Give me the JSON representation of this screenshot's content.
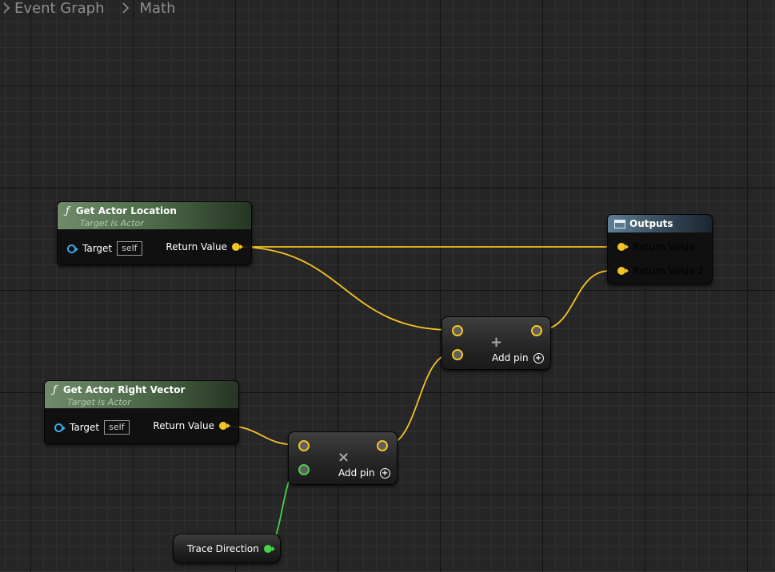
{
  "breadcrumb": {
    "items": [
      "Event Graph",
      "Math"
    ]
  },
  "colors": {
    "vector_wire": "#f5c324",
    "float_wire": "#48d24a",
    "object_pin": "#38a8e8"
  },
  "nodes": {
    "get_actor_location": {
      "icon": "function-icon",
      "glyph": "ƒ",
      "title": "Get Actor Location",
      "subtitle": "Target is Actor",
      "target_label": "Target",
      "target_value": "self",
      "return_label": "Return Value"
    },
    "get_actor_right_vector": {
      "icon": "function-icon",
      "glyph": "ƒ",
      "title": "Get Actor Right Vector",
      "subtitle": "Target is Actor",
      "target_label": "Target",
      "target_value": "self",
      "return_label": "Return Value"
    },
    "add_node": {
      "symbol": "+",
      "add_pin_label": "Add pin",
      "add_pin_glyph": "+"
    },
    "multiply_node": {
      "symbol": "×",
      "add_pin_label": "Add pin",
      "add_pin_glyph": "+"
    },
    "outputs": {
      "icon": "output-icon",
      "title": "Outputs",
      "pins": [
        "Return Value",
        "Return Value 2"
      ]
    },
    "trace_direction": {
      "label": "Trace Direction"
    }
  }
}
